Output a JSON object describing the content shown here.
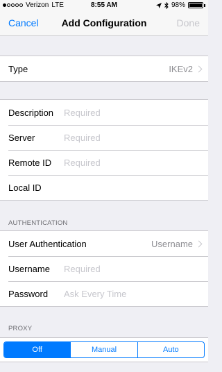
{
  "status": {
    "carrier": "Verizon",
    "network": "LTE",
    "time": "8:55 AM",
    "battery": "98%",
    "battery_level": 0.98
  },
  "nav": {
    "cancel": "Cancel",
    "title": "Add Configuration",
    "done": "Done"
  },
  "type_row": {
    "label": "Type",
    "value": "IKEv2"
  },
  "fields": {
    "description": {
      "label": "Description",
      "placeholder": "Required"
    },
    "server": {
      "label": "Server",
      "placeholder": "Required"
    },
    "remote_id": {
      "label": "Remote ID",
      "placeholder": "Required"
    },
    "local_id": {
      "label": "Local ID",
      "placeholder": ""
    }
  },
  "authentication": {
    "header": "AUTHENTICATION",
    "user_auth": {
      "label": "User Authentication",
      "value": "Username"
    },
    "username": {
      "label": "Username",
      "placeholder": "Required"
    },
    "password": {
      "label": "Password",
      "placeholder": "Ask Every Time"
    }
  },
  "proxy": {
    "header": "PROXY",
    "options": [
      "Off",
      "Manual",
      "Auto"
    ],
    "selected": "Off"
  },
  "colors": {
    "accent": "#007aff",
    "placeholder": "#c7c7cd",
    "background": "#efeff4"
  }
}
